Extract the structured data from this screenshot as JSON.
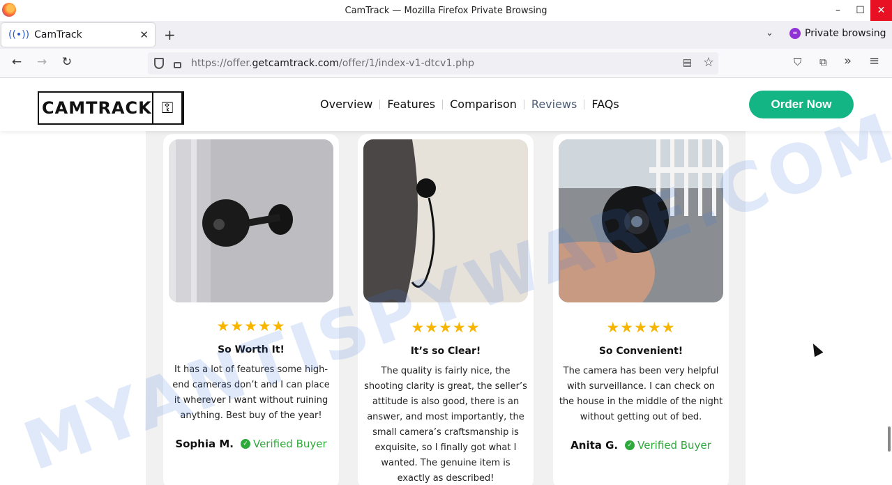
{
  "window": {
    "title": "CamTrack — Mozilla Firefox Private Browsing",
    "minimize": "–",
    "maximize": "☐",
    "close": "✕"
  },
  "tabs": {
    "active_label": "CamTrack",
    "new_tab": "+",
    "list_all": "⌄",
    "private_label": "Private browsing"
  },
  "navbar": {
    "back": "←",
    "forward": "→",
    "reload": "↻",
    "url_prefix": "https://offer.",
    "url_domain": "getcamtrack.com",
    "url_path": "/offer/1/index-v1-dtcv1.php",
    "reader": "▤",
    "bookmark": "☆",
    "pocket": "⛉",
    "extensions": "⧉",
    "overflow": "»",
    "menu": "≡"
  },
  "site": {
    "logo_text": "CAMTRACK",
    "logo_icon": "key-icon",
    "menu": [
      "Overview",
      "Features",
      "Comparison",
      "Reviews",
      "FAQs"
    ],
    "active_menu": "Reviews",
    "order_button": "Order Now"
  },
  "reviews": [
    {
      "stars": "★★★★★",
      "rating": 5,
      "title": "So Worth It!",
      "body": "It has a lot of features some high-end cameras don’t and I can place it wherever I want without ruining anything. Best buy of the year!",
      "author": "Sophia M.",
      "badge": "Verified Buyer"
    },
    {
      "stars": "★★★★★",
      "rating": 5,
      "title": "It’s so Clear!",
      "body": "The quality is fairly nice, the shooting clarity is great, the seller’s attitude is also good, there is an answer, and most importantly, the small camera’s craftsmanship is exquisite, so I finally got what I wanted. The genuine item is exactly as described!",
      "author": "",
      "badge": ""
    },
    {
      "stars": "★★★★★",
      "rating": 5,
      "title": "So Convenient!",
      "body": "The camera has been very helpful with surveillance. I can check on the house in the middle of the night without getting out of bed.",
      "author": "Anita G.",
      "badge": "Verified Buyer"
    }
  ],
  "watermark": "MYANTISPYWARE.COM",
  "colors": {
    "accent": "#14b584",
    "star": "#f7b500",
    "verified": "#2eaa3c",
    "private": "#8f33d6"
  }
}
